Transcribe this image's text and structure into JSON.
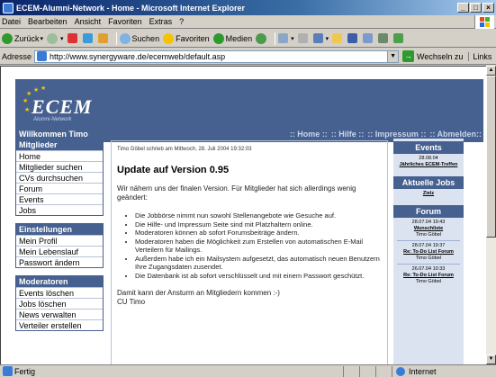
{
  "window": {
    "title": "ECEM-Alumni-Network - Home - Microsoft Internet Explorer"
  },
  "menu": [
    "Datei",
    "Bearbeiten",
    "Ansicht",
    "Favoriten",
    "Extras",
    "?"
  ],
  "toolbar": {
    "back": "Zurück",
    "search": "Suchen",
    "favorites": "Favoriten",
    "media": "Medien"
  },
  "address": {
    "label": "Adresse",
    "url": "http://www.synergyware.de/ecemweb/default.asp",
    "go": "Wechseln zu",
    "links": "Links"
  },
  "site": {
    "logo": "ECEM",
    "logo_tag": "Alumni-Network",
    "welcome": "Willkommen Timo",
    "nav": [
      ":: Home ::",
      ":: Hilfe ::",
      ":: Impressum ::",
      ":: Abmelden::"
    ]
  },
  "sidebar": {
    "mitglieder": {
      "title": "Mitglieder",
      "items": [
        "Home",
        "Mitglieder suchen",
        "CVs durchsuchen",
        "Forum",
        "Events",
        "Jobs"
      ]
    },
    "einstellungen": {
      "title": "Einstellungen",
      "items": [
        "Mein Profil",
        "Mein Lebenslauf",
        "Passwort ändern"
      ]
    },
    "moderatoren": {
      "title": "Moderatoren",
      "items": [
        "Events löschen",
        "Jobs löschen",
        "News verwalten",
        "Verteiler erstellen"
      ]
    }
  },
  "article": {
    "meta": "Timo Göbel schrieb am Mittwoch, 28. Juli 2004 19:32:03",
    "headline": "Update auf Version 0.95",
    "intro": "Wir nähern uns der finalen Version. Für Mitglieder hat sich allerdings wenig geändert:",
    "bullets": [
      "Die Jobbörse nimmt nun sowohl Stellenangebote wie Gesuche auf.",
      "Die Hilfe- und Impressum Seite sind mit Platzhaltern online.",
      "Moderatoren können ab sofort Forumsbeiträge ändern.",
      "Moderatoren haben die Möglichkeit zum Erstellen von automatischen E-Mail Verteilern für Mailings.",
      "Außerdem habe ich ein Mailsystem aufgesetzt, das automatisch neuen Benutzern Ihre Zugangsdaten zusendet.",
      "Die Datenbank ist ab sofort verschlüsselt und mit einem Passwort geschützt."
    ],
    "outro1": "Damit kann der Ansturm an Mitgliedern kommen :-)",
    "outro2": "CU Timo"
  },
  "right": {
    "events": {
      "title": "Events",
      "date": "28.08.04",
      "link": "Jährliches ECEM-Treffen"
    },
    "jobs": {
      "title": "Aktuelle Jobs",
      "link": "Zielz"
    },
    "forum": {
      "title": "Forum",
      "posts": [
        {
          "date": "28.07.04 19:43",
          "link": "Wunschliste",
          "author": "Timo Göbel"
        },
        {
          "date": "28.07.04 19:37",
          "link": "Re: To-Do List Forum",
          "author": "Timo Göbel"
        },
        {
          "date": "26.07.04 10:33",
          "link": "Re: To-Do List Forum",
          "author": "Timo Göbel"
        }
      ]
    }
  },
  "status": {
    "text": "Fertig",
    "zone": "Internet"
  }
}
